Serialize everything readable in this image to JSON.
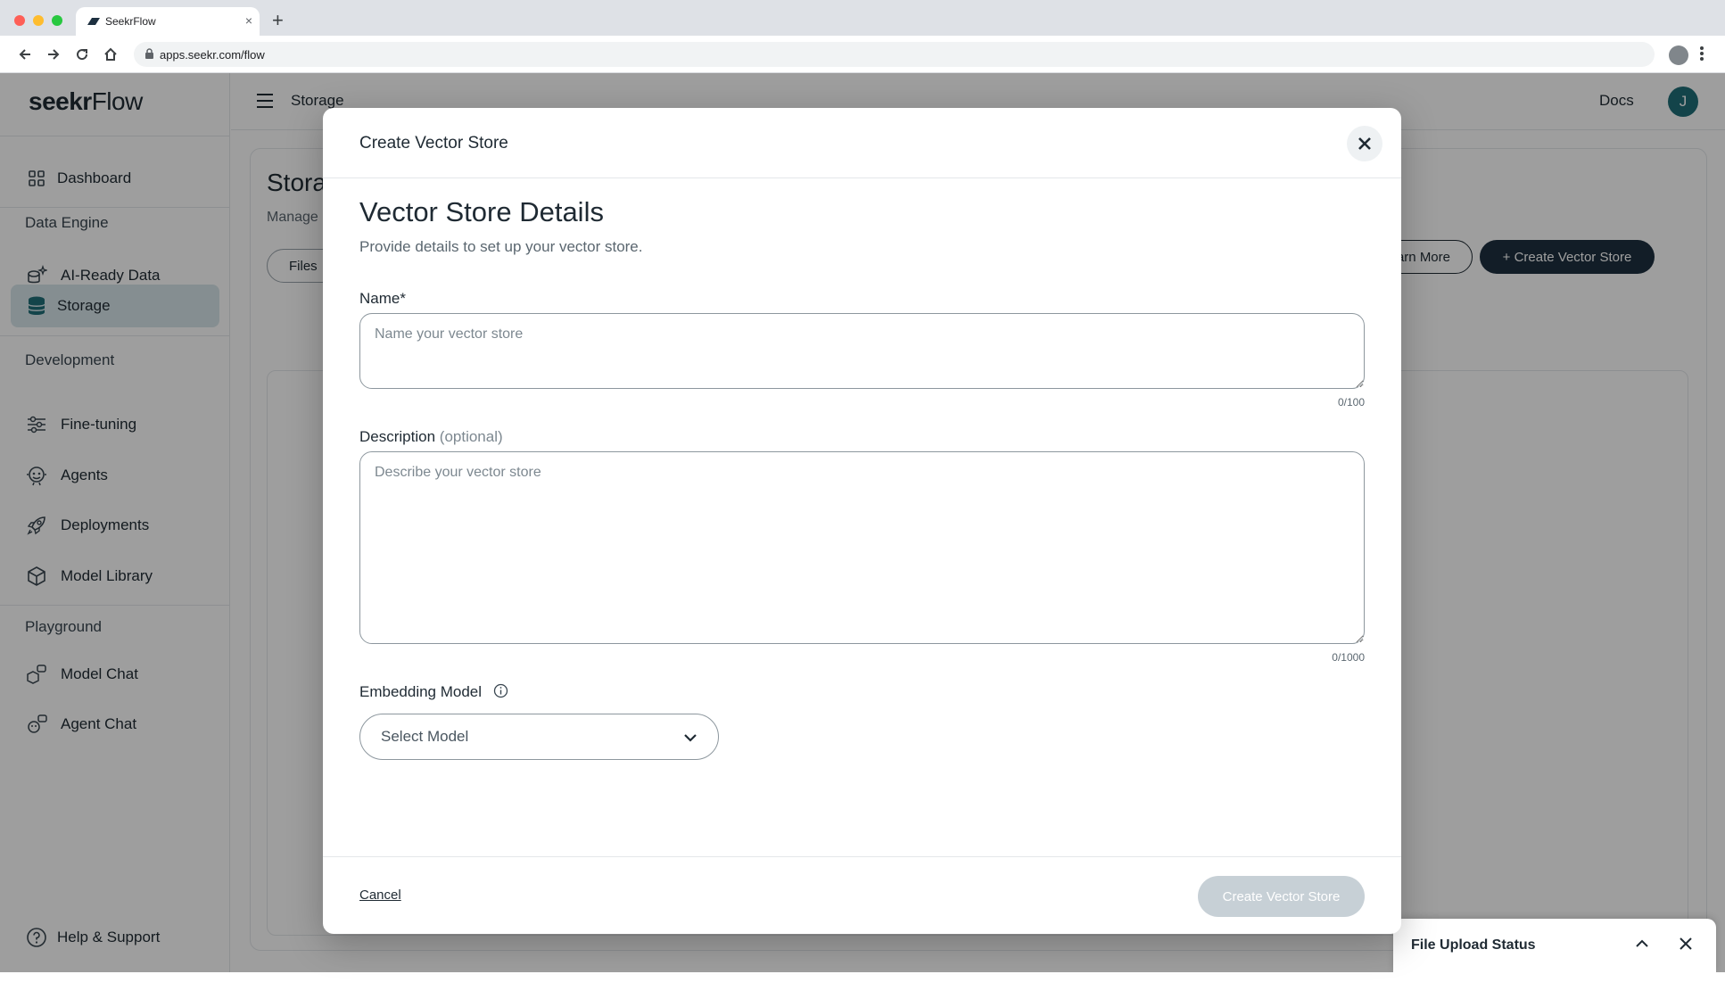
{
  "browser": {
    "tab_title": "SeekrFlow",
    "new_tab_symbol": "+",
    "tab_close_symbol": "×",
    "url": "apps.seekr.com/flow"
  },
  "sidebar": {
    "logo_bold": "seekr",
    "logo_light": "Flow",
    "dashboard": "Dashboard",
    "sections": {
      "data_engine": "Data Engine",
      "development": "Development",
      "playground": "Playground"
    },
    "items": {
      "ai_ready_data": "AI-Ready Data",
      "storage": "Storage",
      "fine_tuning": "Fine-tuning",
      "agents": "Agents",
      "deployments": "Deployments",
      "model_library": "Model Library",
      "model_chat": "Model Chat",
      "agent_chat": "Agent Chat"
    },
    "help": "Help & Support",
    "active_item": "storage"
  },
  "topbar": {
    "breadcrumb": "Storage",
    "docs": "Docs",
    "avatar_initial": "J"
  },
  "page": {
    "title": "Stora",
    "subtitle": "Manage",
    "files_tab": "Files",
    "learn_more": "Learn More",
    "create_button": "+ Create Vector Store"
  },
  "modal": {
    "header_title": "Create Vector Store",
    "section_title": "Vector Store Details",
    "section_subtitle": "Provide details to set up your vector store.",
    "name_label": "Name*",
    "name_placeholder": "Name your vector store",
    "name_counter": "0/100",
    "description_label": "Description",
    "description_optional": "(optional)",
    "description_placeholder": "Describe your vector store",
    "description_counter": "0/1000",
    "embedding_label": "Embedding Model",
    "select_value": "Select Model",
    "cancel": "Cancel",
    "submit": "Create Vector Store"
  },
  "upload_status": {
    "title": "File Upload Status"
  },
  "colors": {
    "accent": "#1d3040",
    "active_nav": "#d7e6ea",
    "avatar": "#1f6f78",
    "disabled_button": "#c7d0d6"
  }
}
